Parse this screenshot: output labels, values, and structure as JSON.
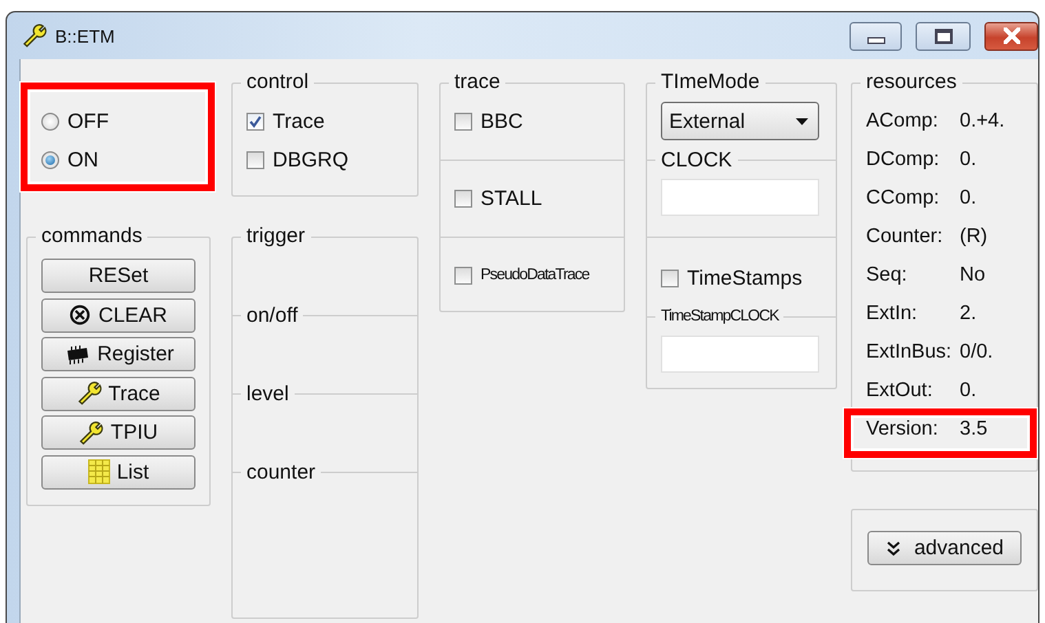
{
  "window": {
    "title": "B::ETM"
  },
  "state": {
    "highlighted": true,
    "options": [
      {
        "label": "OFF",
        "selected": false
      },
      {
        "label": "ON",
        "selected": true
      }
    ]
  },
  "control": {
    "title": "control",
    "items": [
      {
        "label": "Trace",
        "checked": true
      },
      {
        "label": "DBGRQ",
        "checked": false
      }
    ]
  },
  "trace": {
    "title": "trace",
    "items": [
      {
        "label": "BBC",
        "checked": false
      },
      {
        "label": "STALL",
        "checked": false
      },
      {
        "label": "PseudoDataTrace",
        "checked": false
      }
    ]
  },
  "time_mode": {
    "title": "TImeMode",
    "dropdown": {
      "value": "External"
    },
    "clock": {
      "title": "CLOCK"
    },
    "timestamps": {
      "label": "TimeStamps",
      "checked": false
    },
    "timestamp_clock": {
      "title": "TimeStampCLOCK"
    }
  },
  "resources": {
    "title": "resources",
    "rows": [
      {
        "name": "AComp:",
        "value": "0.+4.",
        "highlighted": false
      },
      {
        "name": "DComp:",
        "value": "0.",
        "highlighted": false
      },
      {
        "name": "CComp:",
        "value": "0.",
        "highlighted": false
      },
      {
        "name": "Counter:",
        "value": "(R)",
        "highlighted": false
      },
      {
        "name": "Seq:",
        "value": "No",
        "highlighted": false
      },
      {
        "name": "ExtIn:",
        "value": "2.",
        "highlighted": false
      },
      {
        "name": "ExtInBus:",
        "value": "0/0.",
        "highlighted": false
      },
      {
        "name": "ExtOut:",
        "value": "0.",
        "highlighted": false
      },
      {
        "name": "Version:",
        "value": "3.5",
        "highlighted": true
      }
    ]
  },
  "commands": {
    "title": "commands",
    "buttons": [
      {
        "label": "RESet",
        "kind": "plain"
      },
      {
        "label": "CLEAR",
        "kind": "clear"
      },
      {
        "label": "Register",
        "kind": "chip"
      },
      {
        "label": "Trace",
        "kind": "wrench"
      },
      {
        "label": "TPIU",
        "kind": "wrench"
      },
      {
        "label": "List",
        "kind": "list"
      }
    ]
  },
  "trigger": {
    "title": "trigger",
    "sections": [
      "on/off",
      "level",
      "counter"
    ]
  },
  "advanced": {
    "label": "advanced"
  }
}
